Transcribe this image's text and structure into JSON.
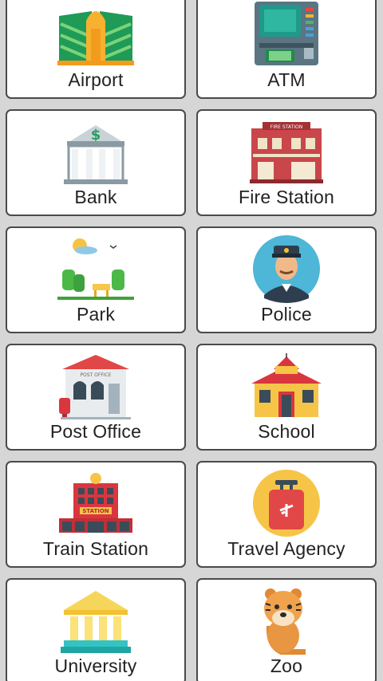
{
  "places": [
    {
      "label": "Airport",
      "icon": "airport-icon"
    },
    {
      "label": "ATM",
      "icon": "atm-icon"
    },
    {
      "label": "Bank",
      "icon": "bank-icon"
    },
    {
      "label": "Fire Station",
      "icon": "fire-station-icon"
    },
    {
      "label": "Park",
      "icon": "park-icon"
    },
    {
      "label": "Police",
      "icon": "police-icon"
    },
    {
      "label": "Post Office",
      "icon": "post-office-icon"
    },
    {
      "label": "School",
      "icon": "school-icon"
    },
    {
      "label": "Train Station",
      "icon": "train-station-icon"
    },
    {
      "label": "Travel Agency",
      "icon": "travel-agency-icon"
    },
    {
      "label": "University",
      "icon": "university-icon"
    },
    {
      "label": "Zoo",
      "icon": "zoo-icon"
    }
  ],
  "icon_text": {
    "bank_symbol": "$",
    "fire_sign": "FIRE STATION",
    "post_sign": "POST OFFICE",
    "train_sign": "STATION"
  }
}
